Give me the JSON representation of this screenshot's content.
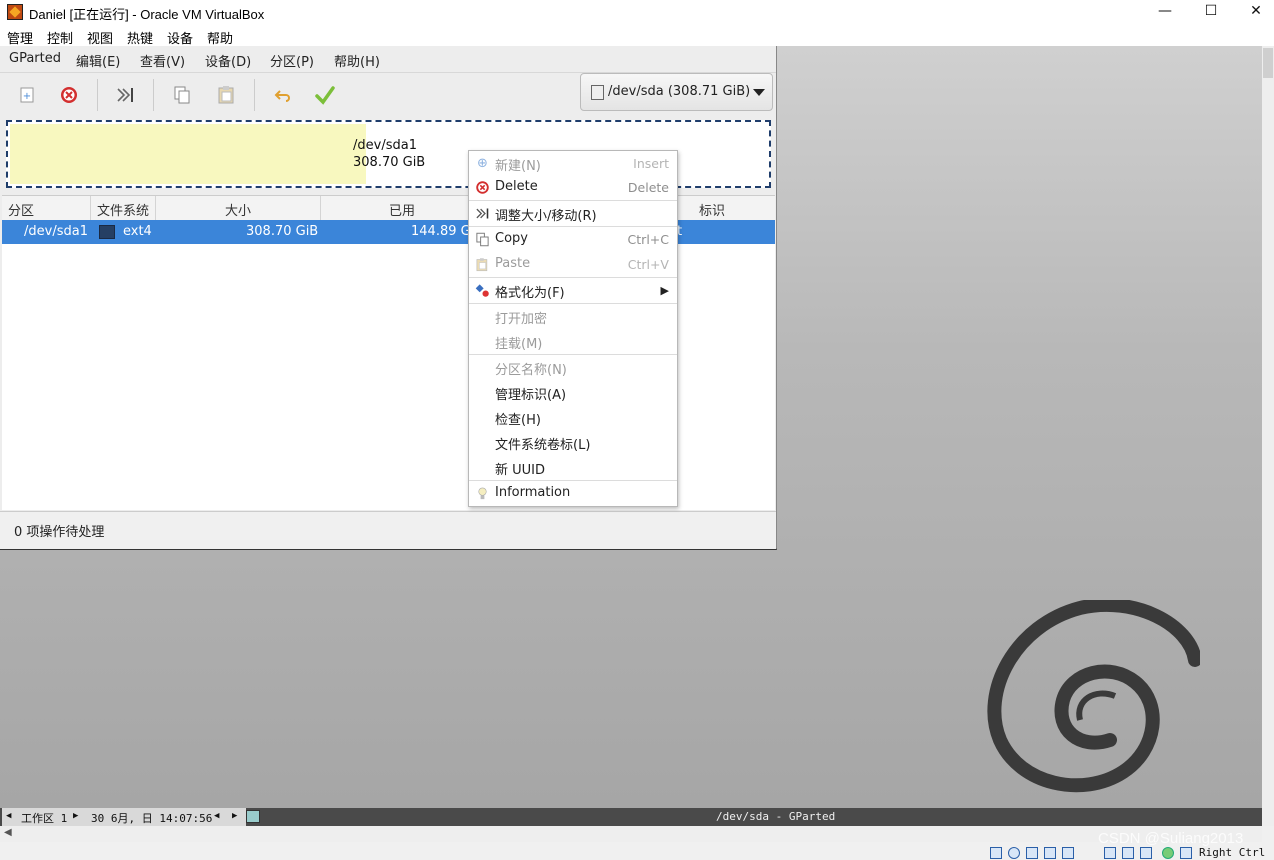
{
  "window": {
    "title": "Daniel [正在运行] - Oracle VM VirtualBox",
    "controls": {
      "minimize": "—",
      "maximize": "☐",
      "close": "✕"
    }
  },
  "host_menu": [
    "管理",
    "控制",
    "视图",
    "热键",
    "设备",
    "帮助"
  ],
  "gparted": {
    "menu": [
      "GParted",
      "编辑(E)",
      "查看(V)",
      "设备(D)",
      "分区(P)",
      "帮助(H)"
    ],
    "toolbar": {
      "icons": [
        "new-icon",
        "delete-icon",
        "resize-move-icon",
        "copy-icon",
        "paste-icon",
        "undo-icon",
        "apply-icon"
      ]
    },
    "device_selector": "/dev/sda (308.71 GiB)",
    "disk_visual": {
      "partition": "/dev/sda1",
      "size": "308.70 GiB",
      "used_fraction": 0.47
    },
    "columns": [
      "分区",
      "文件系统",
      "大小",
      "已用",
      "标识"
    ],
    "rows": [
      {
        "partition": "/dev/sda1",
        "filesystem": "ext4",
        "size": "308.70 GiB",
        "used": "144.89 G",
        "flags": "ot"
      }
    ],
    "status": "0 项操作待处理"
  },
  "context_menu": {
    "items": [
      {
        "label": "新建(N)",
        "shortcut": "Insert",
        "icon": "new-icon",
        "enabled": false
      },
      {
        "label": "Delete",
        "shortcut": "Delete",
        "icon": "delete-icon",
        "enabled": true
      },
      {
        "label": "调整大小/移动(R)",
        "shortcut": "",
        "icon": "resize-move-icon",
        "enabled": true
      },
      {
        "label": "Copy",
        "shortcut": "Ctrl+C",
        "icon": "copy-icon",
        "enabled": true
      },
      {
        "label": "Paste",
        "shortcut": "Ctrl+V",
        "icon": "paste-icon",
        "enabled": false
      },
      {
        "label": "格式化为(F)",
        "shortcut": "▶",
        "icon": "format-icon",
        "enabled": true
      },
      {
        "label": "打开加密",
        "shortcut": "",
        "icon": "",
        "enabled": false
      },
      {
        "label": "挂载(M)",
        "shortcut": "",
        "icon": "",
        "enabled": false
      },
      {
        "label": "分区名称(N)",
        "shortcut": "",
        "icon": "",
        "enabled": false
      },
      {
        "label": "管理标识(A)",
        "shortcut": "",
        "icon": "",
        "enabled": true
      },
      {
        "label": "检查(H)",
        "shortcut": "",
        "icon": "",
        "enabled": true
      },
      {
        "label": "文件系统卷标(L)",
        "shortcut": "",
        "icon": "",
        "enabled": true
      },
      {
        "label": "新 UUID",
        "shortcut": "",
        "icon": "",
        "enabled": true
      },
      {
        "label": "Information",
        "shortcut": "",
        "icon": "info-icon",
        "enabled": true
      }
    ]
  },
  "vm_taskbar": {
    "workspace": "工作区 1",
    "datetime": "30 6月, 日 14:07:56",
    "active_window": "/dev/sda - GParted"
  },
  "host_status": {
    "host_key": "Right Ctrl"
  },
  "watermark": "CSDN @Suliang2013",
  "colors": {
    "selection": "#3b85d9",
    "unallocated_fill": "#f8f8bf",
    "fs_ext4": "#253f63"
  }
}
